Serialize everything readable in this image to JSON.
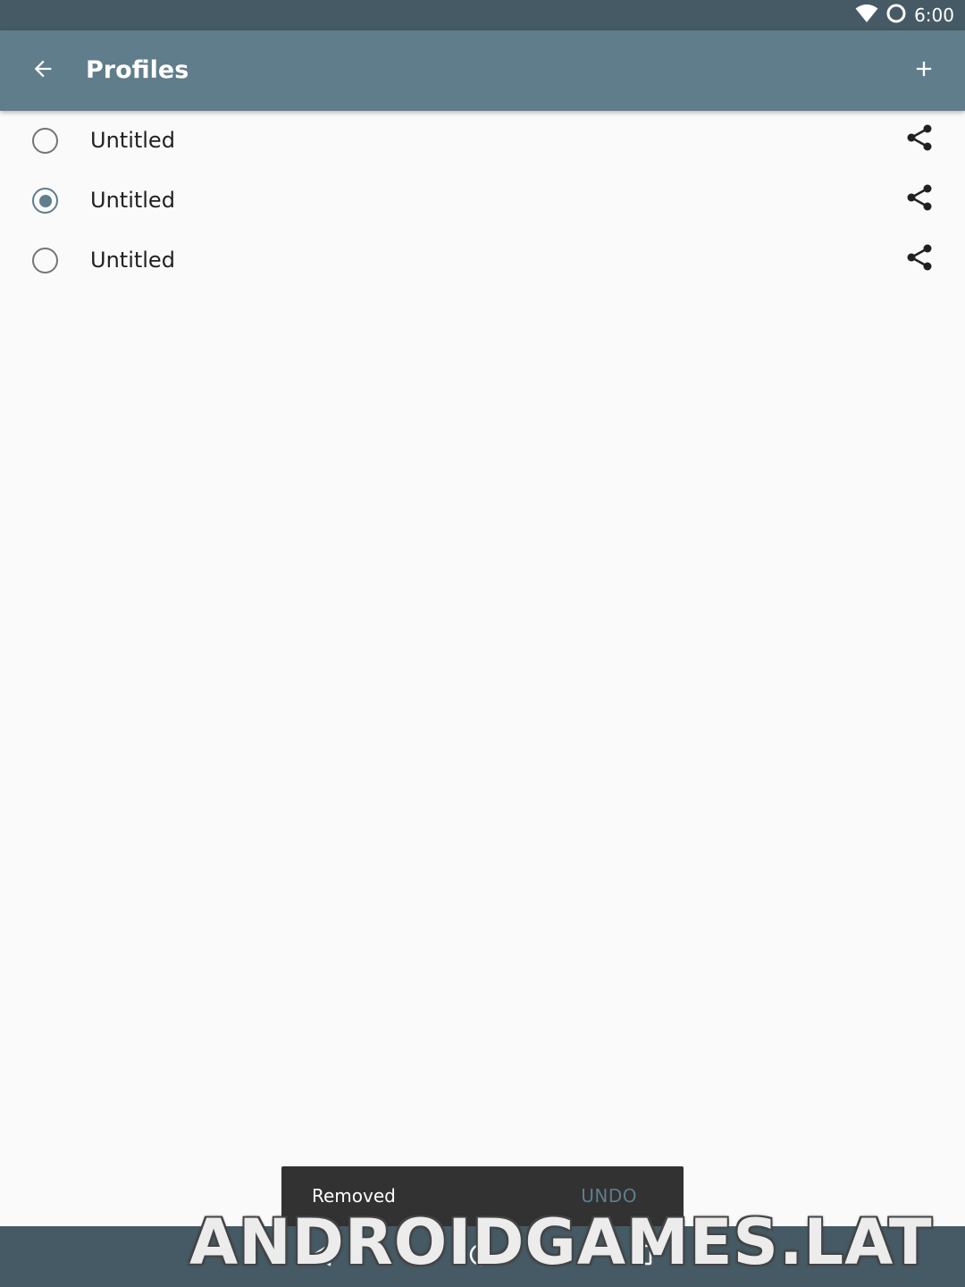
{
  "status_bar": {
    "time": "6:00",
    "icons": [
      "wifi-icon",
      "sync-icon"
    ]
  },
  "toolbar": {
    "title": "Profiles",
    "back_icon": "arrow-back-icon",
    "add_icon": "plus-icon"
  },
  "profiles": [
    {
      "label": "Untitled",
      "selected": false,
      "action_icon": "share-icon"
    },
    {
      "label": "Untitled",
      "selected": true,
      "action_icon": "share-icon"
    },
    {
      "label": "Untitled",
      "selected": false,
      "action_icon": "share-icon"
    }
  ],
  "snackbar": {
    "message": "Removed",
    "action": "UNDO"
  },
  "nav_bar": {
    "icons": [
      "nav-back-icon",
      "nav-home-icon",
      "nav-recents-icon"
    ]
  },
  "watermark": "ANDROIDGAMES.LAT",
  "colors": {
    "primary": "#607d8b",
    "primary_dark": "#455a64",
    "background": "#fafafa",
    "snackbar": "#323232"
  }
}
